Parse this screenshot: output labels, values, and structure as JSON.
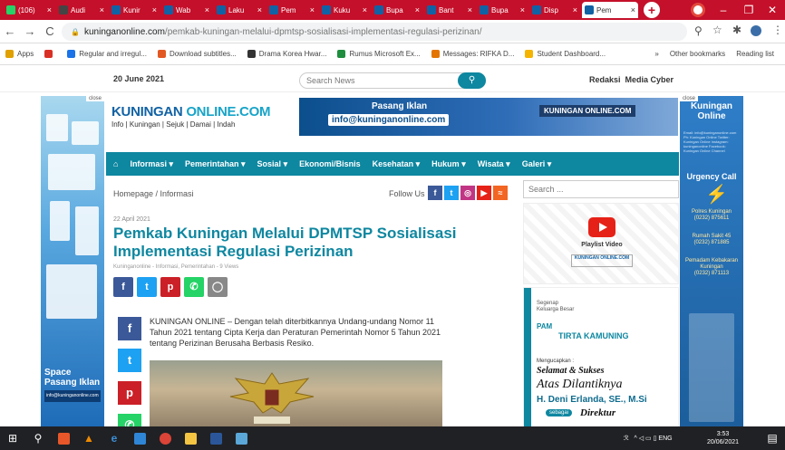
{
  "browser": {
    "tabs": [
      {
        "title": "(106)",
        "icon": "whatsapp-icon",
        "color": "#25d366"
      },
      {
        "title": "Audi",
        "icon": "chrome-icon",
        "color": "#444"
      },
      {
        "title": "Kunir",
        "icon": "kuningan-icon",
        "color": "#1162a4"
      },
      {
        "title": "Wab",
        "icon": "kuningan-icon",
        "color": "#1162a4"
      },
      {
        "title": "Laku",
        "icon": "kuningan-icon",
        "color": "#1162a4"
      },
      {
        "title": "Pem",
        "icon": "kuningan-icon",
        "color": "#1162a4"
      },
      {
        "title": "Kuku",
        "icon": "kuningan-icon",
        "color": "#1162a4"
      },
      {
        "title": "Bupa",
        "icon": "kuningan-icon",
        "color": "#1162a4"
      },
      {
        "title": "Bant",
        "icon": "kuningan-icon",
        "color": "#1162a4"
      },
      {
        "title": "Bupa",
        "icon": "kuningan-icon",
        "color": "#1162a4"
      },
      {
        "title": "Disp",
        "icon": "kuningan-icon",
        "color": "#1162a4"
      },
      {
        "title": "Pem",
        "icon": "kuningan-icon",
        "color": "#1162a4",
        "active": true
      }
    ],
    "url_host": "kuninganonline.com",
    "url_path": "/pemkab-kuningan-melalui-dpmtsp-sosialisasi-implementasi-regulasi-perizinan/",
    "accent": "#c4102a"
  },
  "bookmarks": {
    "items": [
      {
        "label": "Apps",
        "color": "#e0a000"
      },
      {
        "label": "",
        "color": "#d93025"
      },
      {
        "label": "Regular and irregul...",
        "color": "#1a73e8"
      },
      {
        "label": "Download subtitles...",
        "color": "#e25822"
      },
      {
        "label": "Drama Korea Hwar...",
        "color": "#333"
      },
      {
        "label": "Rumus Microsoft Ex...",
        "color": "#1e8e3e"
      },
      {
        "label": "Messages: RIFKA D...",
        "color": "#e37400"
      },
      {
        "label": "Student Dashboard...",
        "color": "#f4b400"
      }
    ],
    "more": "»",
    "other": "Other bookmarks",
    "reading": "Reading list"
  },
  "site": {
    "date": "20 June 2021",
    "search_placeholder": "Search News",
    "redaksi": "Redaksi",
    "media_cyber": "Media Cyber",
    "logo_k": "KUNINGAN ",
    "logo_o": "ONLINE.COM",
    "tagline": "Info | Kuningan | Sejuk | Damai | Indah",
    "ad_title": "Pasang Iklan",
    "ad_email": "info@kuninganonline.com",
    "ad_logo": "KUNINGAN ONLINE.COM",
    "close": "close",
    "menu": [
      "Informasi",
      "Pemerintahan",
      "Sosial",
      "Ekonomi/Bisnis",
      "Kesehatan",
      "Hukum",
      "Wisata",
      "Galeri"
    ]
  },
  "leftban": {
    "line1": "Space",
    "line2": "Pasang Iklan",
    "email": "info@kuninganonline.com"
  },
  "rightban": {
    "title1": "Kuningan",
    "title2": "Online",
    "title3": "...",
    "small": "Email: info@kuninganonline.com Ph: Kuningan Online Twitter: Kuningan Online Instagram: kuninganonline Facebook: Kuningan Online Channel",
    "urgency": "Urgency Call",
    "contacts": [
      {
        "name": "Polres Kuningan",
        "phone": "(0232) 875611"
      },
      {
        "name": "Rumah Sakit 45",
        "phone": "(0232) 871885"
      },
      {
        "name": "Pemadam Kebakaran Kuningan",
        "phone": "(0232) 871113"
      }
    ]
  },
  "article": {
    "breadcrumb": "Homepage / Informasi",
    "follow": "Follow Us",
    "date": "22 April 2021",
    "title": "Pemkab Kuningan Melalui DPMTSP Sosialisasi Implementasi Regulasi Perizinan",
    "meta": "Kuninganonline - Informasi, Pemerintahan - 9 Views",
    "body": "KUNINGAN ONLINE – Dengan telah diterbitkannya Undang-undang Nomor 11 Tahun 2021 tentang Cipta Kerja dan Peraturan Pemerintah Nomor 5 Tahun 2021 tentang Perizinan Berusaha Berbasis Resiko."
  },
  "sidebar": {
    "search_placeholder": "Search ...",
    "playlist": "Playlist Video",
    "pllogo": "KUNINGAN ONLINE.COM",
    "pam": {
      "segenap1": "Segenap",
      "segenap2": "Keluarga Besar",
      "pam": "PAM",
      "tirta": "TIRTA KAMUNING",
      "mengucapkan": "Mengucapkan :",
      "selamat": "Selamat & Sukses",
      "atas": "Atas Dilantiknya",
      "nama": "H. Deni Erlanda, SE., M.Si",
      "sebagai": "sebagai",
      "direktur": "Direktur"
    }
  },
  "taskbar": {
    "time": "3:53",
    "date": "20/06/2021",
    "lang": "ENG"
  }
}
